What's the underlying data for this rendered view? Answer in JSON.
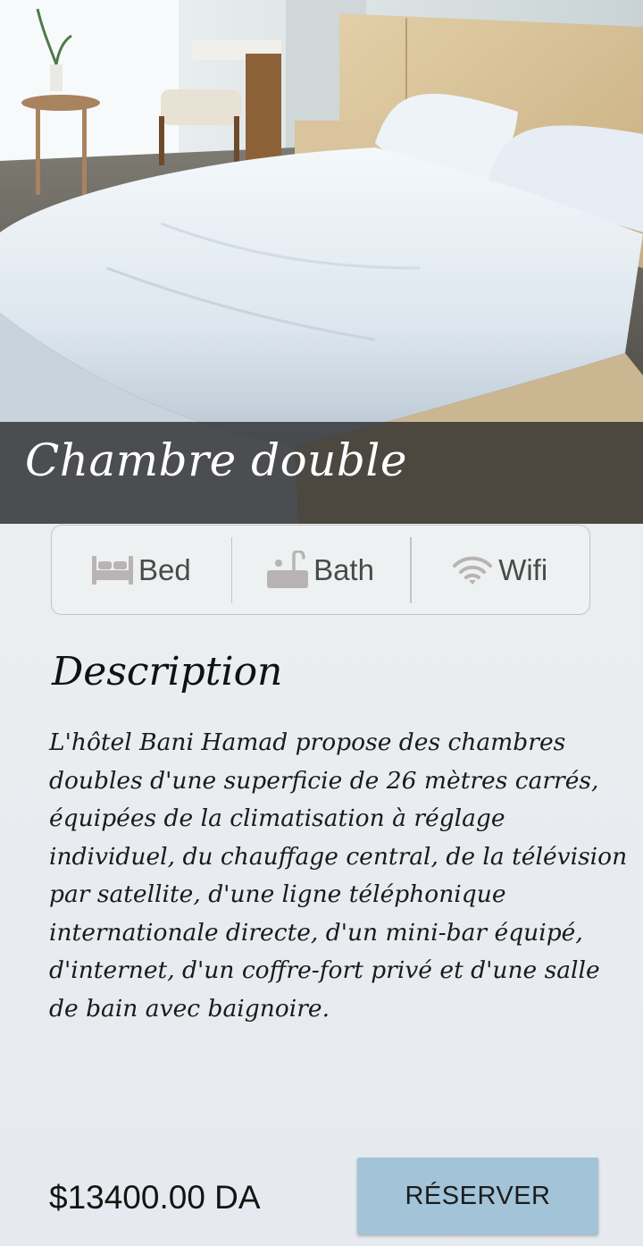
{
  "room": {
    "title": "Chambre double",
    "photo_icon": "hotel-room-photo"
  },
  "amenities": [
    {
      "label": "Bed",
      "icon": "bed-icon"
    },
    {
      "label": "Bath",
      "icon": "bathtub-icon"
    },
    {
      "label": "Wifi",
      "icon": "wifi-icon"
    }
  ],
  "description": {
    "heading": "Description",
    "text": "L'hôtel Bani Hamad propose des chambres doubles d'une superficie de 26 mètres carrés, équipées de la climatisation à réglage individuel, du chauffage central, de la télévision par satellite, d'une ligne téléphonique internationale directe, d'un mini-bar équipé, d'internet, d'un coffre-fort privé et d'une salle de bain avec baignoire."
  },
  "footer": {
    "price": "$13400.00 DA",
    "reserve_label": "RÉSERVER"
  },
  "colors": {
    "button": "#a3c4d8",
    "icon": "#b9b3b3",
    "title_overlay": "#282828"
  }
}
